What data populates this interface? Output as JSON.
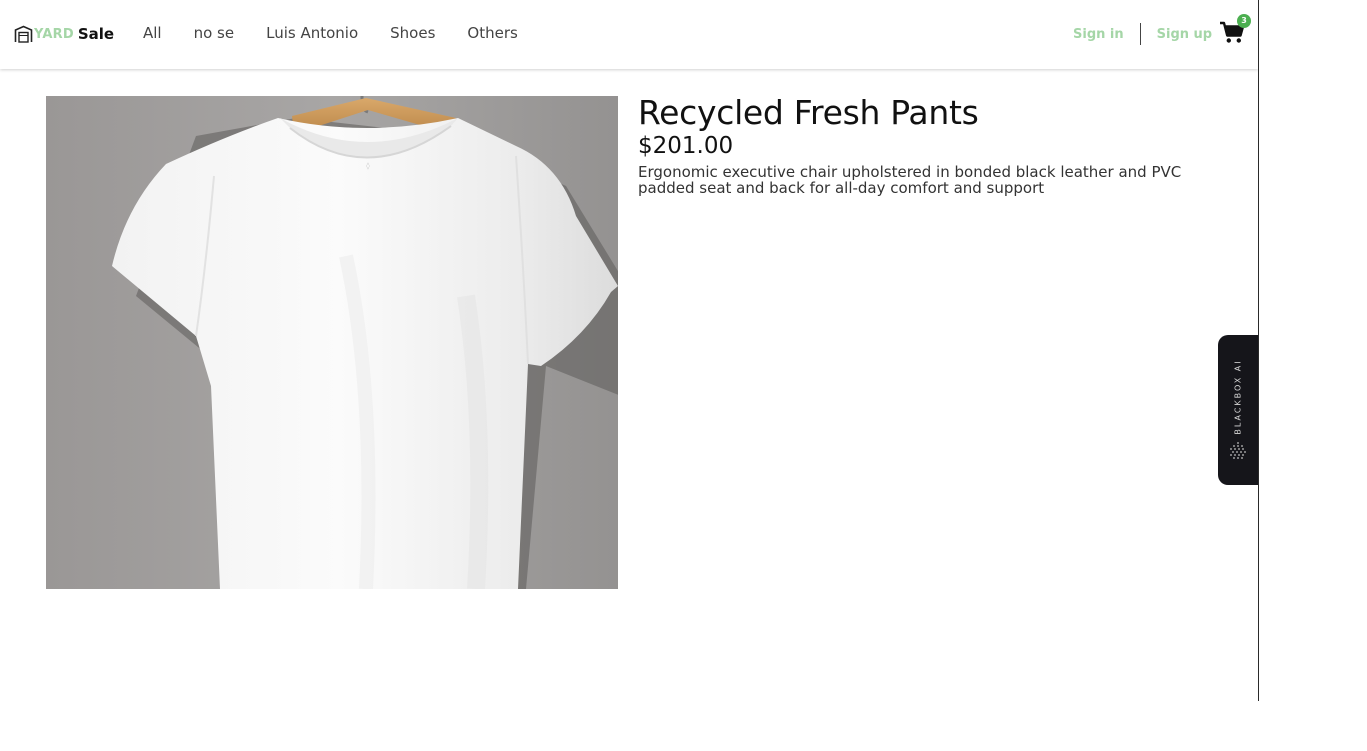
{
  "header": {
    "brand": {
      "yard": "YARD",
      "sale": "Sale"
    },
    "nav": [
      "All",
      "no se",
      "Luis Antonio",
      "Shoes",
      "Others"
    ],
    "auth": {
      "sign_in": "Sign in",
      "sign_up": "Sign up"
    },
    "cart": {
      "count": "3"
    }
  },
  "product": {
    "title": "Recycled Fresh Pants",
    "price": "$201.00",
    "description": "Ergonomic executive chair upholstered in bonded black leather and PVC padded seat and back for all-day comfort and support"
  },
  "blackbox": {
    "label": "BLACKBOX AI"
  },
  "colors": {
    "accent_green": "#a5d6a7",
    "badge_green": "#4caf50",
    "blackbox_bg": "#15151a"
  }
}
